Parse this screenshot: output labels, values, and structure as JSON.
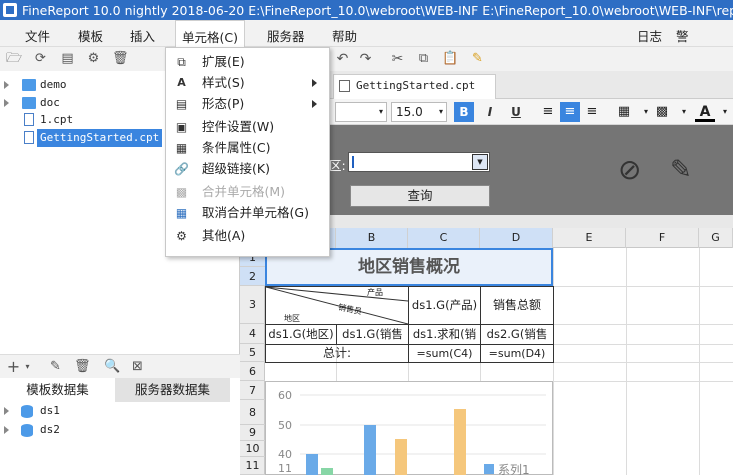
{
  "titlebar": {
    "title": "FineReport 10.0 nightly 2018-06-20 E:\\FineReport_10.0\\webroot\\WEB-INF    E:\\FineReport_10.0\\webroot\\WEB-INF\\reportlets"
  },
  "menubar": {
    "items": [
      "文件",
      "模板",
      "插入",
      "单元格(C)",
      "服务器",
      "帮助"
    ],
    "right": [
      "日志",
      "警告:14:2"
    ]
  },
  "file_tree": {
    "items": [
      {
        "label": "demo",
        "type": "folder"
      },
      {
        "label": "doc",
        "type": "folder"
      },
      {
        "label": "1.cpt",
        "type": "file"
      },
      {
        "label": "GettingStarted.cpt",
        "type": "file",
        "selected": true
      }
    ]
  },
  "dataset_tabs": [
    "模板数据集",
    "服务器数据集"
  ],
  "datasets": [
    "ds1",
    "ds2"
  ],
  "doc_tab": {
    "label": "GettingStarted.cpt"
  },
  "format_bar": {
    "font_size": "15.0",
    "bold": "B",
    "italic": "I",
    "underline": "U",
    "font_color": "A"
  },
  "param_pane": {
    "label_suffix": "区:",
    "query_button": "查询"
  },
  "columns": [
    "A",
    "B",
    "C",
    "D",
    "E",
    "F",
    "G"
  ],
  "rows": [
    "1",
    "2",
    "3",
    "4",
    "5",
    "6",
    "7",
    "8",
    "9",
    "10",
    "11"
  ],
  "report": {
    "title": "地区销售概况",
    "header_product": "产品",
    "header_salesperson": "销售员",
    "header_region": "地区",
    "c3": "ds1.G(产品)",
    "d3": "销售总额",
    "a4": "ds1.G(地区)",
    "b4": "ds1.G(销售",
    "c4": "ds1.求和(销",
    "d4": "ds2.G(销售",
    "a5": "总计:",
    "c5": "=sum(C4)",
    "d5": "=sum(D4)"
  },
  "chart_data": {
    "type": "bar",
    "ylim": [
      0,
      60
    ],
    "yticks": [
      "60",
      "50",
      "40",
      "11"
    ],
    "legend": "系列1",
    "colors": {
      "blue": "#6aaae8",
      "yellow": "#f5c77c",
      "green": "#87d6a6"
    }
  },
  "cell_menu": {
    "items": [
      {
        "label": "扩展(E)",
        "icon": "expand-icon",
        "sub": false,
        "disabled": false
      },
      {
        "label": "样式(S)",
        "icon": "style-icon",
        "sub": true,
        "disabled": false
      },
      {
        "label": "形态(P)",
        "icon": "form-icon",
        "sub": true,
        "disabled": false
      },
      {
        "label": "控件设置(W)",
        "icon": "widget-icon",
        "sub": false,
        "disabled": false
      },
      {
        "label": "条件属性(C)",
        "icon": "condition-icon",
        "sub": false,
        "disabled": false
      },
      {
        "label": "超级链接(K)",
        "icon": "link-icon",
        "sub": false,
        "disabled": false
      },
      {
        "label": "合并单元格(M)",
        "icon": "merge-icon",
        "sub": false,
        "disabled": true
      },
      {
        "label": "取消合并单元格(G)",
        "icon": "unmerge-icon",
        "sub": false,
        "disabled": false
      },
      {
        "label": "其他(A)",
        "icon": "gear-icon",
        "sub": false,
        "disabled": false
      }
    ]
  }
}
